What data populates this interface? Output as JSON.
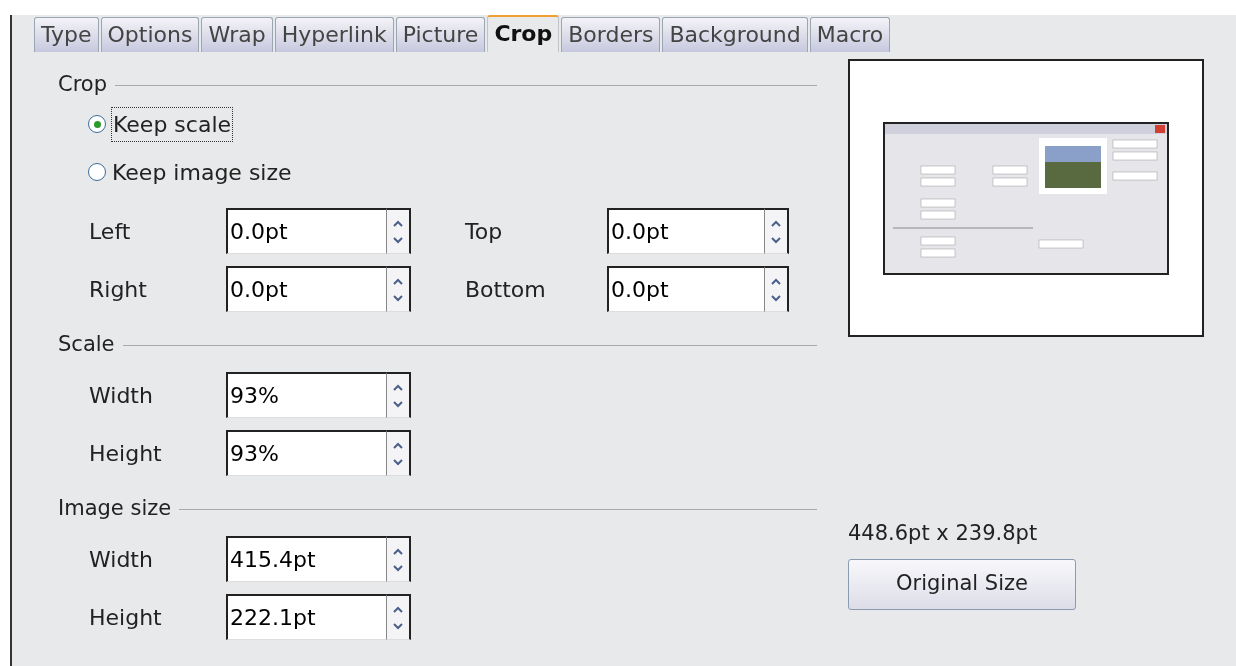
{
  "tabs": [
    {
      "label": "Type",
      "selected": false
    },
    {
      "label": "Options",
      "selected": false
    },
    {
      "label": "Wrap",
      "selected": false
    },
    {
      "label": "Hyperlink",
      "selected": false
    },
    {
      "label": "Picture",
      "selected": false
    },
    {
      "label": "Crop",
      "selected": true
    },
    {
      "label": "Borders",
      "selected": false
    },
    {
      "label": "Background",
      "selected": false
    },
    {
      "label": "Macro",
      "selected": false
    }
  ],
  "crop": {
    "title": "Crop",
    "radios": [
      {
        "label": "Keep scale",
        "selected": true
      },
      {
        "label": "Keep image size",
        "selected": false
      }
    ],
    "fields": [
      {
        "label": "Left",
        "value": "0.0pt"
      },
      {
        "label": "Top",
        "value": "0.0pt"
      },
      {
        "label": "Right",
        "value": "0.0pt"
      },
      {
        "label": "Bottom",
        "value": "0.0pt"
      }
    ]
  },
  "scale": {
    "title": "Scale",
    "fields": [
      {
        "label": "Width",
        "value": "93%"
      },
      {
        "label": "Height",
        "value": "93%"
      }
    ]
  },
  "image_size": {
    "title": "Image size",
    "fields": [
      {
        "label": "Width",
        "value": "415.4pt"
      },
      {
        "label": "Height",
        "value": "222.1pt"
      }
    ]
  },
  "original_size": {
    "text": "448.6pt x 239.8pt",
    "button": "Original Size"
  }
}
